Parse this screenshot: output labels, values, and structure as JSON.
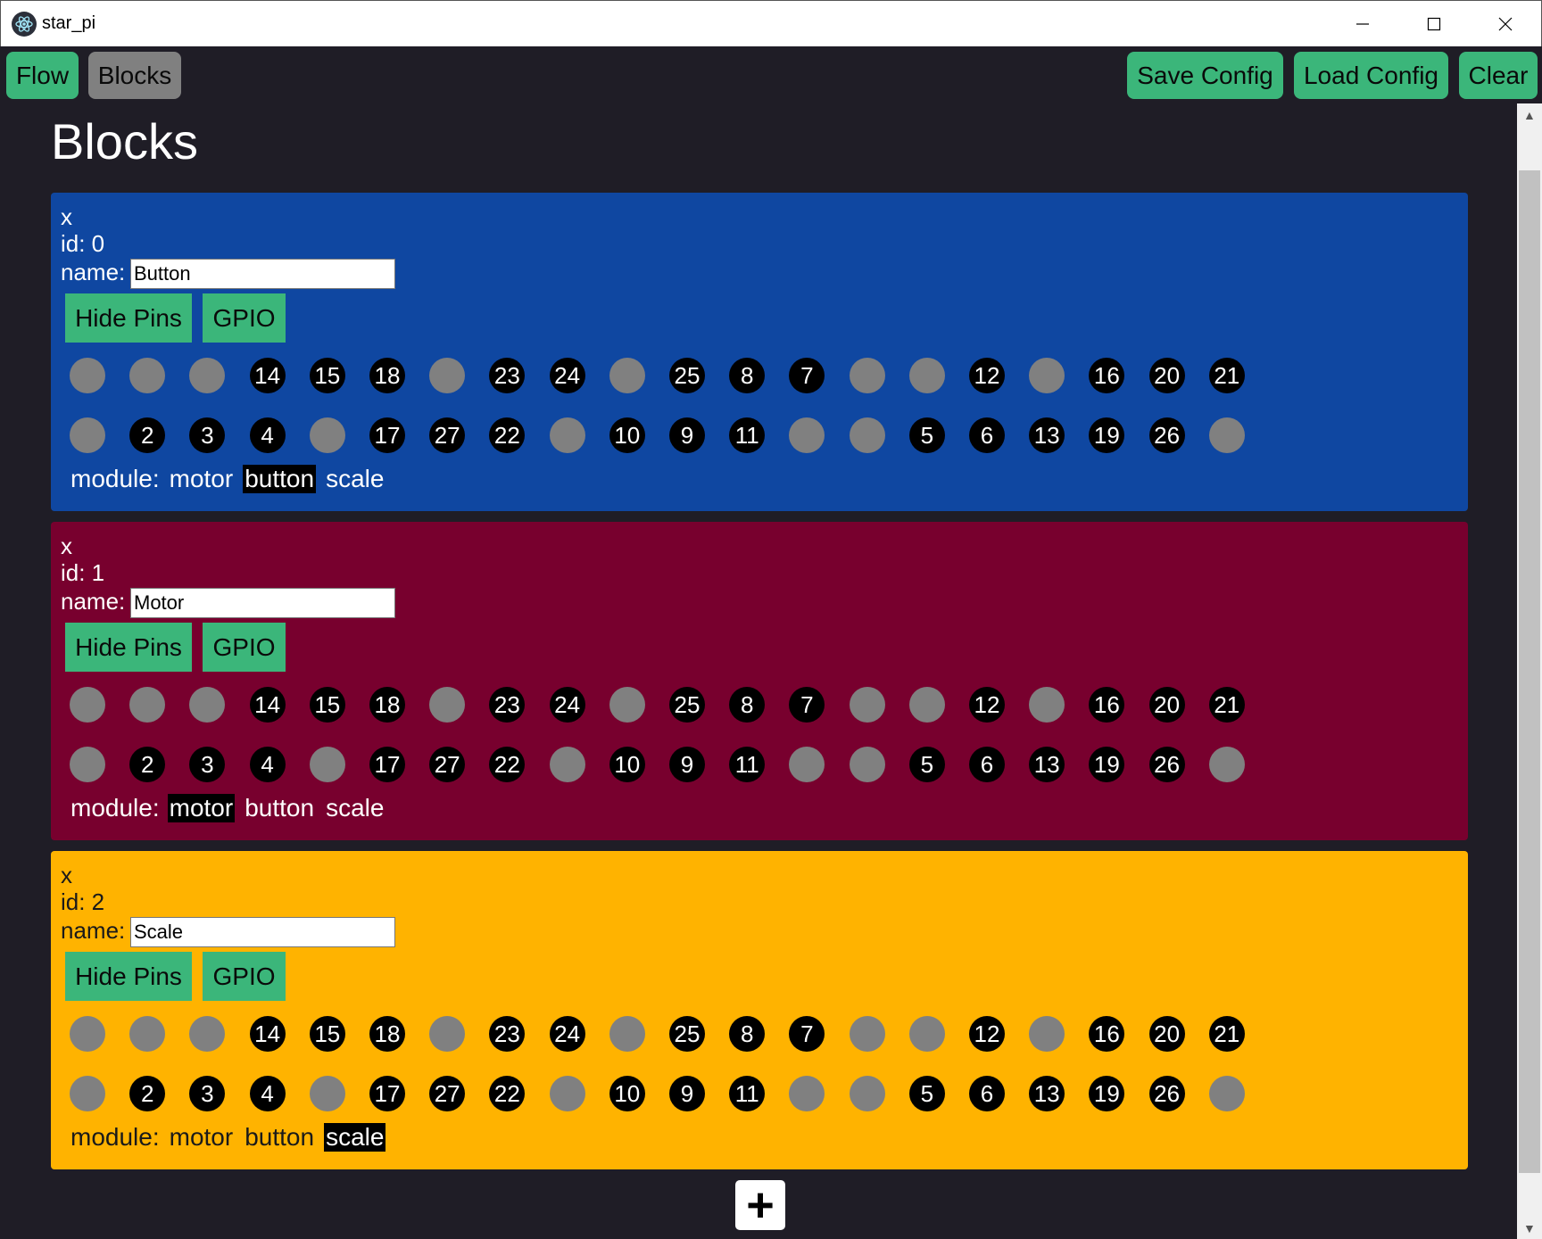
{
  "window": {
    "title": "star_pi",
    "minimize_glyph": "—",
    "maximize_glyph": "☐",
    "close_glyph": "✕"
  },
  "toolbar": {
    "flow_label": "Flow",
    "blocks_label": "Blocks",
    "save_label": "Save Config",
    "load_label": "Load Config",
    "clear_label": "Clear"
  },
  "page": {
    "title": "Blocks",
    "add_label": "+"
  },
  "pins": {
    "top": [
      "",
      "",
      "",
      "14",
      "15",
      "18",
      "",
      "23",
      "24",
      "",
      "25",
      "8",
      "7",
      "",
      "",
      "12",
      "",
      "16",
      "20",
      "21"
    ],
    "bottom": [
      "",
      "2",
      "3",
      "4",
      "",
      "17",
      "27",
      "22",
      "",
      "10",
      "9",
      "11",
      "",
      "",
      "5",
      "6",
      "13",
      "19",
      "26",
      ""
    ]
  },
  "blocks": [
    {
      "close": "x",
      "id_text": "id: 0",
      "name_label": "name:",
      "name_value": "Button",
      "hide_pins_label": "Hide Pins",
      "gpio_label": "GPIO",
      "module_label": "module:",
      "modules": [
        "motor",
        "button",
        "scale"
      ],
      "selected_module": "button",
      "bg_color": "#0f47a1",
      "text_color": "#ffffff"
    },
    {
      "close": "x",
      "id_text": "id: 1",
      "name_label": "name:",
      "name_value": "Motor",
      "hide_pins_label": "Hide Pins",
      "gpio_label": "GPIO",
      "module_label": "module:",
      "modules": [
        "motor",
        "button",
        "scale"
      ],
      "selected_module": "motor",
      "bg_color": "#78002e",
      "text_color": "#ffffff"
    },
    {
      "close": "x",
      "id_text": "id: 2",
      "name_label": "name:",
      "name_value": "Scale",
      "hide_pins_label": "Hide Pins",
      "gpio_label": "GPIO",
      "module_label": "module:",
      "modules": [
        "motor",
        "button",
        "scale"
      ],
      "selected_module": "scale",
      "bg_color": "#ffb300",
      "text_color": "#1a1a1a"
    }
  ],
  "colors": {
    "app_bg": "#1f1d26",
    "button_green": "#3bb67a",
    "button_gray": "#808080",
    "pin_empty": "#808080",
    "pin_filled": "#000000"
  }
}
